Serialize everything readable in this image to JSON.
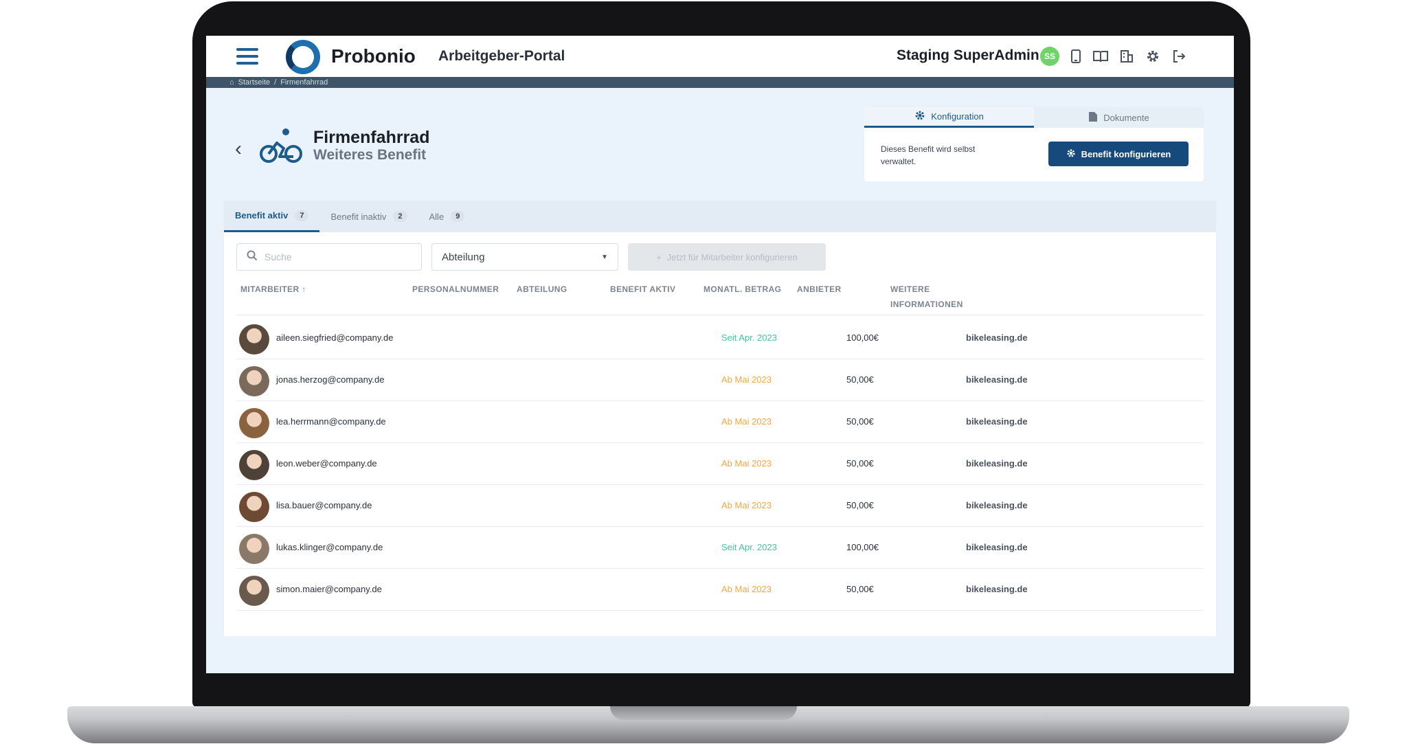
{
  "topbar": {
    "brand": "Probonio",
    "portal": "Arbeitgeber-Portal",
    "user_name": "Staging SuperAdmin",
    "user_initials": "SS",
    "icons": [
      "mobile-icon",
      "book-icon",
      "building-icon",
      "gear-icon",
      "logout-icon"
    ]
  },
  "breadcrumb": {
    "home": "Startseite",
    "separator": "/",
    "current": "Firmenfahrrad"
  },
  "header": {
    "title": "Firmenfahrrad",
    "subtitle": "Weiteres Benefit"
  },
  "config_panel": {
    "tab_config": "Konfiguration",
    "tab_docs": "Dokumente",
    "text": "Dieses Benefit wird selbst verwaltet.",
    "button": "Benefit konfigurieren"
  },
  "tabs": [
    {
      "label": "Benefit aktiv",
      "count": "7"
    },
    {
      "label": "Benefit inaktiv",
      "count": "2"
    },
    {
      "label": "Alle",
      "count": "9"
    }
  ],
  "filters": {
    "search_placeholder": "Suche",
    "department": "Abteilung",
    "employee_button": "Jetzt für Mitarbeiter konfigurieren"
  },
  "columns": {
    "employee": "MITARBEITER ↑",
    "personnel": "PERSONALNUMMER",
    "department": "ABTEILUNG",
    "benefit_active": "BENEFIT AKTIV",
    "monthly": "MONATL. BETRAG",
    "provider": "ANBIETER",
    "more_line1": "WEITERE",
    "more_line2": "INFORMATIONEN"
  },
  "rows": [
    {
      "email": "aileen.siegfried@company.de",
      "status": "Seit Apr. 2023",
      "status_color": "#44c49a",
      "amount": "100,00€",
      "provider": "bikeleasing.de"
    },
    {
      "email": "jonas.herzog@company.de",
      "status": "Ab Mai 2023",
      "status_color": "#f5a742",
      "amount": "50,00€",
      "provider": "bikeleasing.de"
    },
    {
      "email": "lea.herrmann@company.de",
      "status": "Ab Mai 2023",
      "status_color": "#f5a742",
      "amount": "50,00€",
      "provider": "bikeleasing.de"
    },
    {
      "email": "leon.weber@company.de",
      "status": "Ab Mai 2023",
      "status_color": "#f5a742",
      "amount": "50,00€",
      "provider": "bikeleasing.de"
    },
    {
      "email": "lisa.bauer@company.de",
      "status": "Ab Mai 2023",
      "status_color": "#f5a742",
      "amount": "50,00€",
      "provider": "bikeleasing.de"
    },
    {
      "email": "lukas.klinger@company.de",
      "status": "Seit Apr. 2023",
      "status_color": "#44c49a",
      "amount": "100,00€",
      "provider": "bikeleasing.de"
    },
    {
      "email": "simon.maier@company.de",
      "status": "Ab Mai 2023",
      "status_color": "#f5a742",
      "amount": "50,00€",
      "provider": "bikeleasing.de"
    }
  ],
  "colors": {
    "primary": "#174a7c",
    "accent": "#1d6fae",
    "active_green": "#44c49a",
    "pending_orange": "#f5a742"
  }
}
